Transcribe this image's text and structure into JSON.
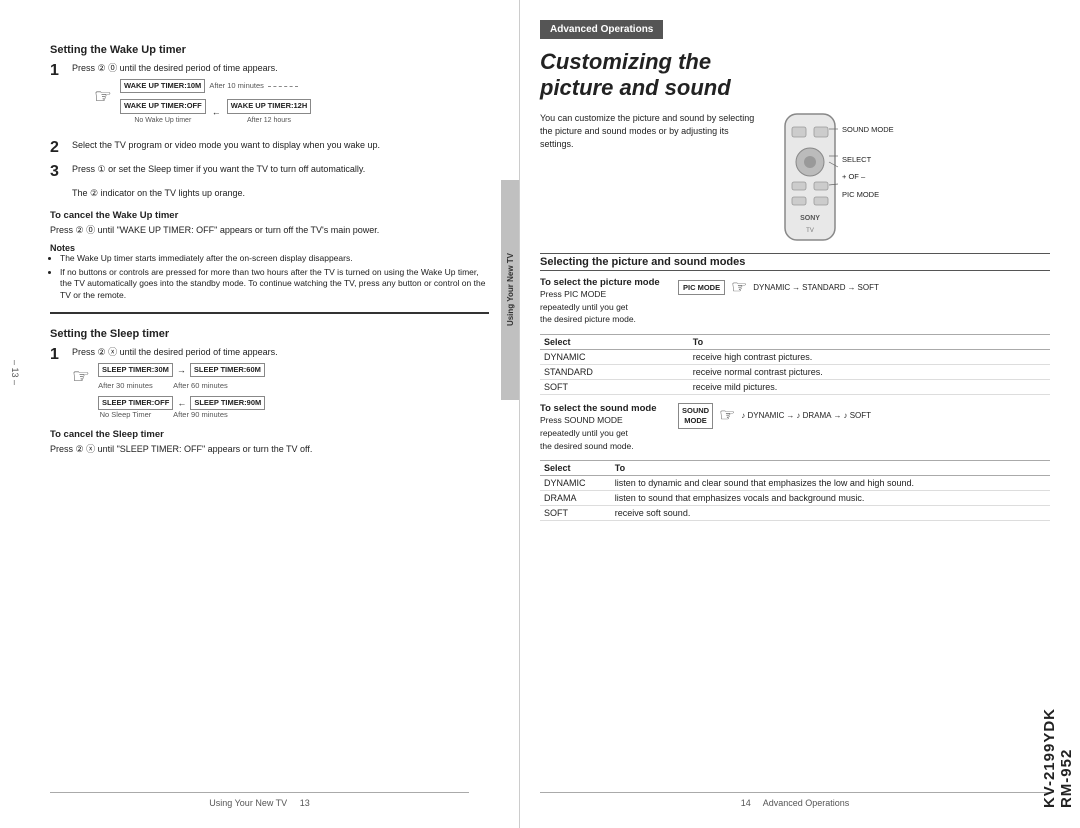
{
  "left_page": {
    "section1": {
      "header": "Setting the Wake Up timer",
      "step1": {
        "num": "1",
        "text": "Press",
        "text2": "until the desired period of time appears."
      },
      "step2": {
        "num": "2",
        "text": "Select the TV program or video mode you want to display when you wake up."
      },
      "step3": {
        "num": "3",
        "text": "Press",
        "text2": "or set the Sleep timer if you want the TV to turn off automatically."
      },
      "indicator_note": "The",
      "indicator_note2": "indicator on the TV lights up orange.",
      "cancel_header": "To cancel the Wake Up timer",
      "cancel_text": "Press",
      "cancel_text2": "until \"WAKE UP TIMER: OFF\" appears or turn off the TV's main power.",
      "notes_header": "Notes",
      "notes": [
        "The Wake Up timer starts immediately after the on-screen display disappears.",
        "If no buttons or controls are pressed for more than two hours after the TV is turned on using the Wake Up timer, the TV automatically goes into the standby mode. To continue watching the TV, press any button or control on the TV or the remote."
      ],
      "timer_boxes": {
        "box1_label": "WAKE UP TIMER:10M",
        "box1_sub": "After 10 minutes",
        "box2_label": "WAKE UP TIMER:OFF",
        "box2_sub": "No Wake Up timer",
        "box3_label": "WAKE UP TIMER:12H",
        "box3_sub": "After 12 hours"
      }
    },
    "section2": {
      "header": "Setting the Sleep timer",
      "step1_text": "Press",
      "step1_text2": "until the desired period of time appears.",
      "cancel_header": "To cancel the Sleep timer",
      "cancel_text": "Press",
      "cancel_text2": "until \"SLEEP TIMER: OFF\" appears or turn the TV off.",
      "timer_boxes": {
        "box1_label": "SLEEP TIMER:30M",
        "box1_sub": "After 30 minutes",
        "box2_label": "SLEEP TIMER:60M",
        "box2_sub": "After 60 minutes",
        "box3_label": "SLEEP TIMER:OFF",
        "box3_sub": "No Sleep Timer",
        "box4_label": "SLEEP TIMER:90M",
        "box4_sub": "After 90 minutes"
      }
    },
    "page_footer": {
      "left_text": "Using Your New TV",
      "page_num": "13",
      "margin_num": "– 13 –"
    }
  },
  "right_page": {
    "badge": "Advanced Operations",
    "title_line1": "Customizing the",
    "title_line2": "picture and sound",
    "intro": "You can customize the picture and sound by selecting the picture and sound modes or by adjusting its settings.",
    "remote_labels": {
      "sound_mode": "SOUND MODE",
      "select": "SELECT",
      "of": "+ OF –",
      "pic_mode": "PIC MODE"
    },
    "sony_label": "SONY",
    "tv_label": "TV",
    "section": {
      "header": "Selecting the picture and sound modes",
      "pic_mode": {
        "sub_header": "To select the picture mode",
        "desc1": "Press PIC MODE",
        "desc2": "repeatedly until you get",
        "desc3": "the desired picture mode.",
        "arrows": "DYNAMIC → STANDARD → SOFT",
        "table_headers": [
          "Select",
          "To"
        ],
        "rows": [
          {
            "select": "DYNAMIC",
            "to": "receive high contrast pictures."
          },
          {
            "select": "STANDARD",
            "to": "receive normal contrast pictures."
          },
          {
            "select": "SOFT",
            "to": "receive mild pictures."
          }
        ]
      },
      "sound_mode": {
        "sub_header": "To select the sound mode",
        "desc1": "Press SOUND MODE",
        "desc2": "repeatedly until you get",
        "desc3": "the desired sound mode.",
        "arrows": "♪ DYNAMIC → ♪ DRAMA → ♪ SOFT",
        "table_headers": [
          "Select",
          "To"
        ],
        "rows": [
          {
            "select": "DYNAMIC",
            "to": "listen to dynamic and clear sound that emphasizes the low and high sound."
          },
          {
            "select": "DRAMA",
            "to": "listen to sound that emphasizes vocals and background music."
          },
          {
            "select": "SOFT",
            "to": "receive soft sound."
          }
        ]
      }
    },
    "page_footer": {
      "page_num": "14",
      "right_text": "Advanced Operations"
    },
    "model_number": "KV-2199YDK",
    "model_number2": "RM-952"
  },
  "vertical_tab": "Using Your New TV"
}
